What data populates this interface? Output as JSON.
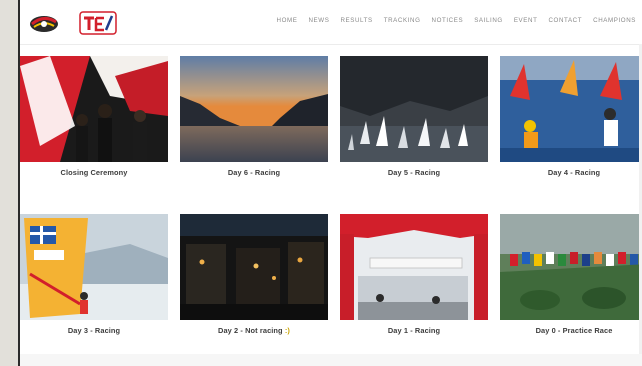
{
  "nav": {
    "items": [
      "Home",
      "News",
      "Results",
      "Tracking",
      "Notices",
      "Sailing",
      "Event",
      "Contact",
      "Champions"
    ]
  },
  "gallery": {
    "items": [
      {
        "caption": "Closing Ceremony",
        "icon": "closing-ceremony-photo"
      },
      {
        "caption": "Day 6 - Racing",
        "icon": "lake-sunset-photo"
      },
      {
        "caption": "Day 5 - Racing",
        "icon": "windsurf-fleet-photo"
      },
      {
        "caption": "Day 4 - Racing",
        "icon": "windsurf-start-photo"
      },
      {
        "caption": "Day 3 - Racing",
        "icon": "greek-windsurfer-photo"
      },
      {
        "caption_main": "Day 2 - Not racing ",
        "caption_accent": ":)",
        "icon": "night-town-photo"
      },
      {
        "caption": "Day 1 - Racing",
        "icon": "event-gate-photo"
      },
      {
        "caption": "Day 0 - Practice Race",
        "icon": "flags-row-photo"
      }
    ]
  },
  "colors": {
    "accent": "#c9a400",
    "flag_red": "#d21f2b",
    "sail_red": "#e0332e"
  }
}
